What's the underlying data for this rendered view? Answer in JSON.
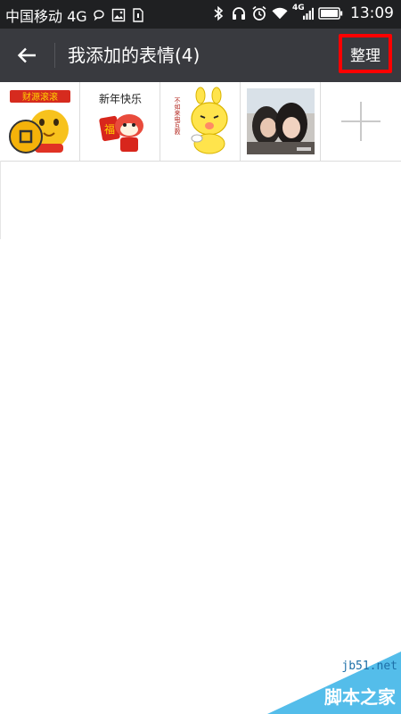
{
  "status_bar": {
    "carrier": "中国移动 4G",
    "network_label": "4G",
    "time": "13:09",
    "icons": [
      "message-icon",
      "image-icon",
      "sim-icon",
      "bluetooth-icon",
      "headset-icon",
      "alarm-icon",
      "wifi-icon",
      "signal-icon",
      "battery-icon"
    ]
  },
  "title_bar": {
    "back_icon": "back-arrow-icon",
    "title": "我添加的表情(4)",
    "manage_label": "整理",
    "highlight_color": "#ff0000"
  },
  "stickers": {
    "items": [
      {
        "name": "sticker-gold-coin",
        "banner": "财源滚滚"
      },
      {
        "name": "sticker-new-year",
        "caption": "新年快乐",
        "badge": "福"
      },
      {
        "name": "sticker-yellow-bunny",
        "caption": "不如来电互救"
      },
      {
        "name": "sticker-photo"
      }
    ],
    "add_icon": "plus-icon"
  },
  "watermark": {
    "site": "jb51.net",
    "name": "脚本之家"
  },
  "colors": {
    "status_bar_bg": "#1f2022",
    "title_bar_bg": "#393a3f",
    "background": "#ffffff",
    "watermark": "#36b1e6"
  }
}
